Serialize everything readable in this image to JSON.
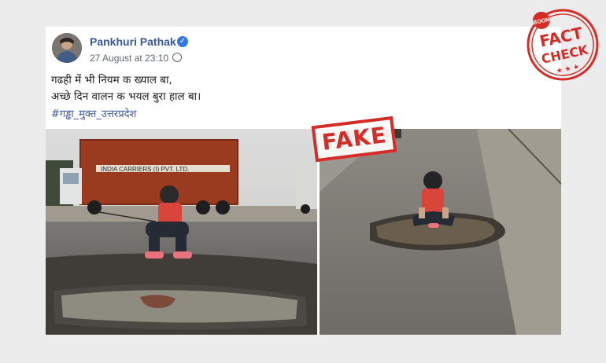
{
  "post": {
    "author": "Pankhuri Pathak",
    "verified_icon": "verified-check-icon",
    "timestamp": "27 August at 23:10",
    "privacy_icon": "globe-icon",
    "text_line1": "गढही में भी नियम क ख्याल बा,",
    "text_line2": "अच्छे दिन वालन क भयल बुरा हाल बा।",
    "hashtag": "#गड्ढा_मुक्त_उत्तरप्रदेश"
  },
  "stamp": {
    "label": "FAKE",
    "color": "#d42c26"
  },
  "badge": {
    "brand": "BOOM",
    "line1": "FACT",
    "line2": "CHECK",
    "color": "#d42c26"
  },
  "photos": {
    "left_truck_text": "INDIA CARRIERS (I) PVT. LTD."
  }
}
